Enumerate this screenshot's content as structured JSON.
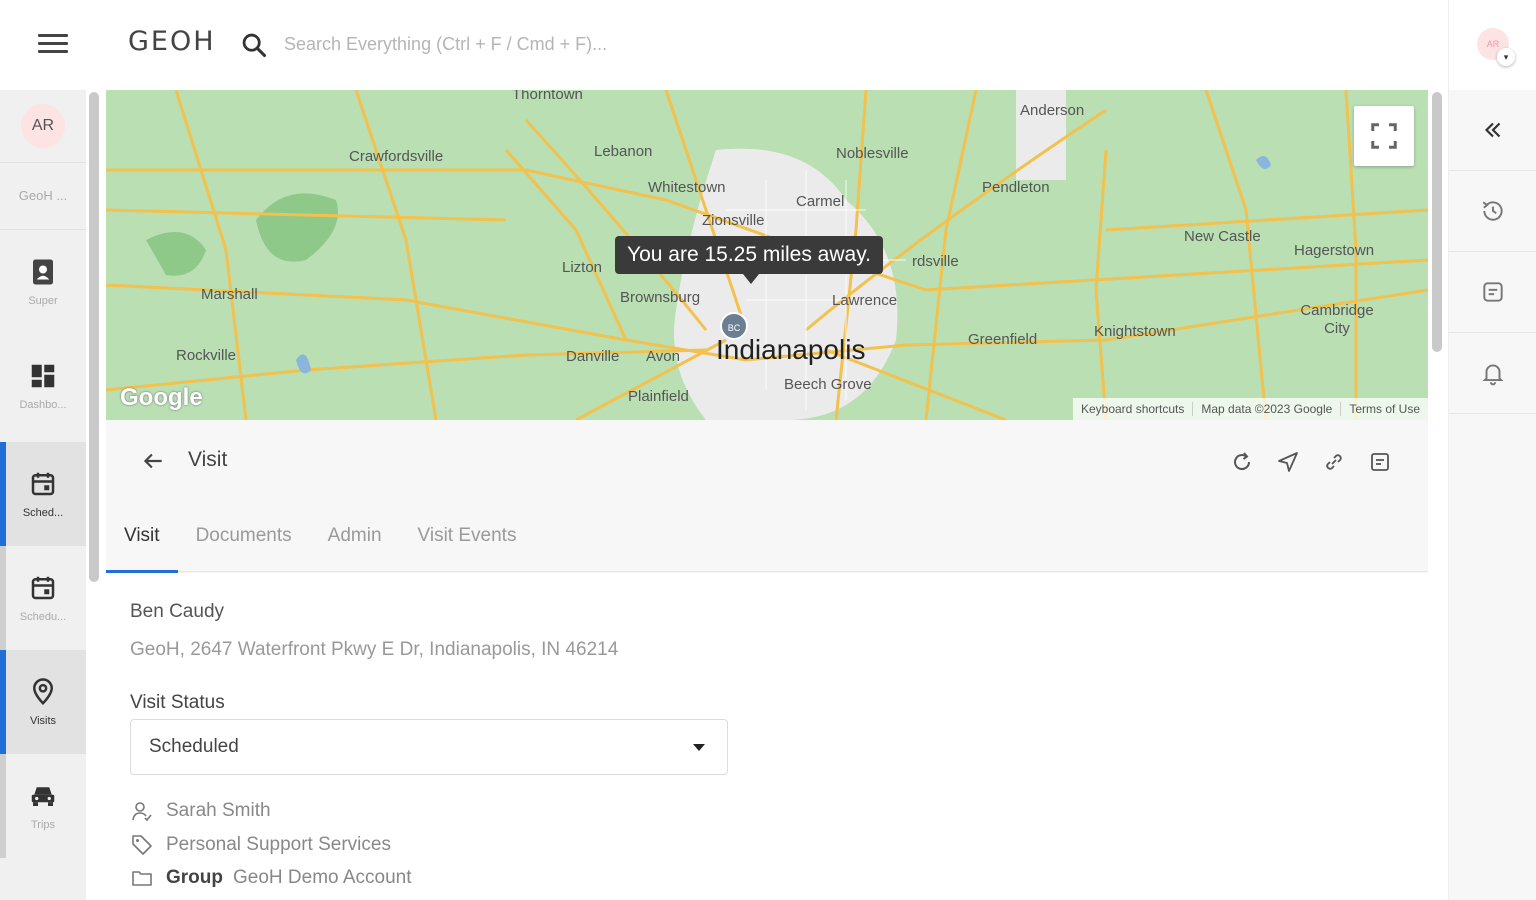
{
  "topbar": {
    "logo": "GEOH",
    "search_placeholder": "Search Everything (Ctrl + F / Cmd + F)..."
  },
  "user": {
    "initials": "AR"
  },
  "sidebar": {
    "avatar_initials": "AR",
    "org_label": "GeoH ...",
    "items": [
      {
        "label": "Super",
        "icon": "badge-icon"
      },
      {
        "label": "Dashbo...",
        "icon": "dashboard-icon"
      },
      {
        "label": "Sched...",
        "icon": "calendar-icon"
      },
      {
        "label": "Schedu...",
        "icon": "calendar-icon"
      },
      {
        "label": "Visits",
        "icon": "location-pin-icon"
      },
      {
        "label": "Trips",
        "icon": "car-icon"
      }
    ]
  },
  "map": {
    "tooltip": "You are 15.25 miles away.",
    "pin_initials": "BC",
    "google": "Google",
    "attribution": [
      "Keyboard shortcuts",
      "Map data ©2023 Google",
      "Terms of Use"
    ],
    "cities": {
      "noblesville": "Noblesville",
      "anderson": "Anderson",
      "crawfordsville": "Crawfordsville",
      "lebanon": "Lebanon",
      "whitestown": "Whitestown",
      "zionsville": "Zionsville",
      "carmel": "Carmel",
      "pendleton": "Pendleton",
      "new_castle": "New Castle",
      "hagerstown": "Hagerstown",
      "lizton": "Lizton",
      "brownsburg": "Brownsburg",
      "lawrence": "Lawrence",
      "fortville": "rdsville",
      "marshall": "Marshall",
      "rockville": "Rockville",
      "danville": "Danville",
      "avon": "Avon",
      "indianapolis": "Indianapolis",
      "greenfield": "Greenfield",
      "knightstown": "Knightstown",
      "cambridge_city": "Cambridge City",
      "beech_grove": "Beech Grove",
      "plainfield": "Plainfield",
      "thorntown": "Thorntown"
    }
  },
  "detail": {
    "title": "Visit",
    "tabs": [
      "Visit",
      "Documents",
      "Admin",
      "Visit Events"
    ],
    "client_name": "Ben Caudy",
    "client_address": "GeoH,  2647 Waterfront Pkwy E Dr, Indianapolis, IN 46214",
    "status_label": "Visit Status",
    "status_value": "Scheduled",
    "assignee": "Sarah Smith",
    "service": "Personal Support Services",
    "group_label": "Group",
    "group_value": "GeoH Demo Account"
  }
}
